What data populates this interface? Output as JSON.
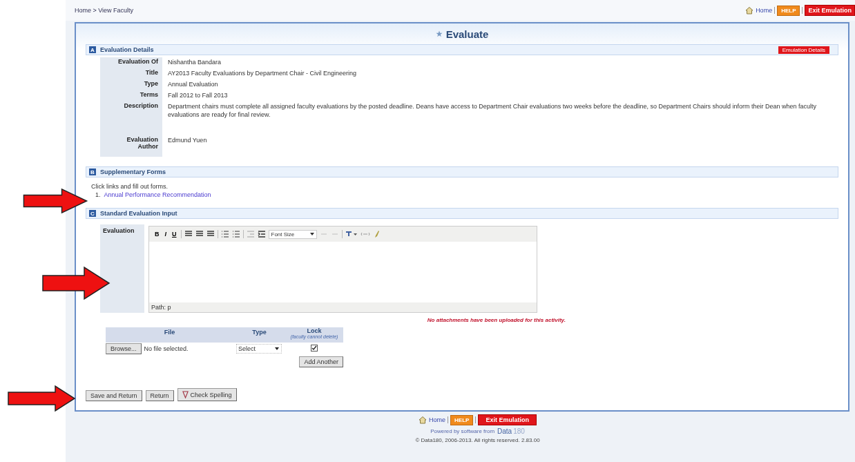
{
  "breadcrumb": "Home > View Faculty",
  "top_links": {
    "home": "Home",
    "help": "HELP",
    "exit": "Exit Emulation"
  },
  "title": "Evaluate",
  "details_section": {
    "letter": "A",
    "title": "Evaluation Details",
    "action": "Emulation Details",
    "fields": [
      {
        "label": "Evaluation Of",
        "value": "Nishantha Bandara"
      },
      {
        "label": "Title",
        "value": "AY2013 Faculty Evaluations by Department Chair - Civil Engineering"
      },
      {
        "label": "Type",
        "value": "Annual Evaluation"
      },
      {
        "label": "Terms",
        "value": "Fall 2012 to Fall 2013"
      },
      {
        "label": "Description",
        "value": "Department chairs must complete all assigned faculty evaluations by the posted deadline. Deans have access to Department Chair evaluations two weeks before the deadline, so Department Chairs should inform their Dean when faculty evaluations are ready for final review."
      },
      {
        "label": "Evaluation Author",
        "value": "Edmund Yuen"
      }
    ]
  },
  "forms_section": {
    "letter": "B",
    "title": "Supplementary Forms",
    "intro": "Click links and fill out forms.",
    "forms": [
      {
        "number": "1.",
        "name": "Annual Performance Recommendation"
      }
    ]
  },
  "input_section": {
    "letter": "C",
    "title": "Standard Evaluation Input",
    "field_label": "Evaluation",
    "toolbar_text": [
      "B",
      "I",
      "U"
    ],
    "font_size": "Font Size",
    "path": "Path: p",
    "attach_note": "No attachments have been uploaded for this activity.",
    "attach_columns": [
      "File",
      "Type",
      "Lock"
    ],
    "lock_hint": "(faculty cannot delete)",
    "browse": "Browse...",
    "file_status": "No file selected.",
    "type_select": "Select",
    "lock_checked": true,
    "add_another": "Add Another"
  },
  "buttons": [
    "Save and Return",
    "Return",
    "Check Spelling"
  ],
  "footer": {
    "home": "Home",
    "help": "HELP",
    "exit": "Exit Emulation",
    "powered": "Powered by software from",
    "brand": "Data",
    "brand_num": "180",
    "copyright": "© Data180, 2006-2013. All rights reserved. 2.83.00"
  }
}
